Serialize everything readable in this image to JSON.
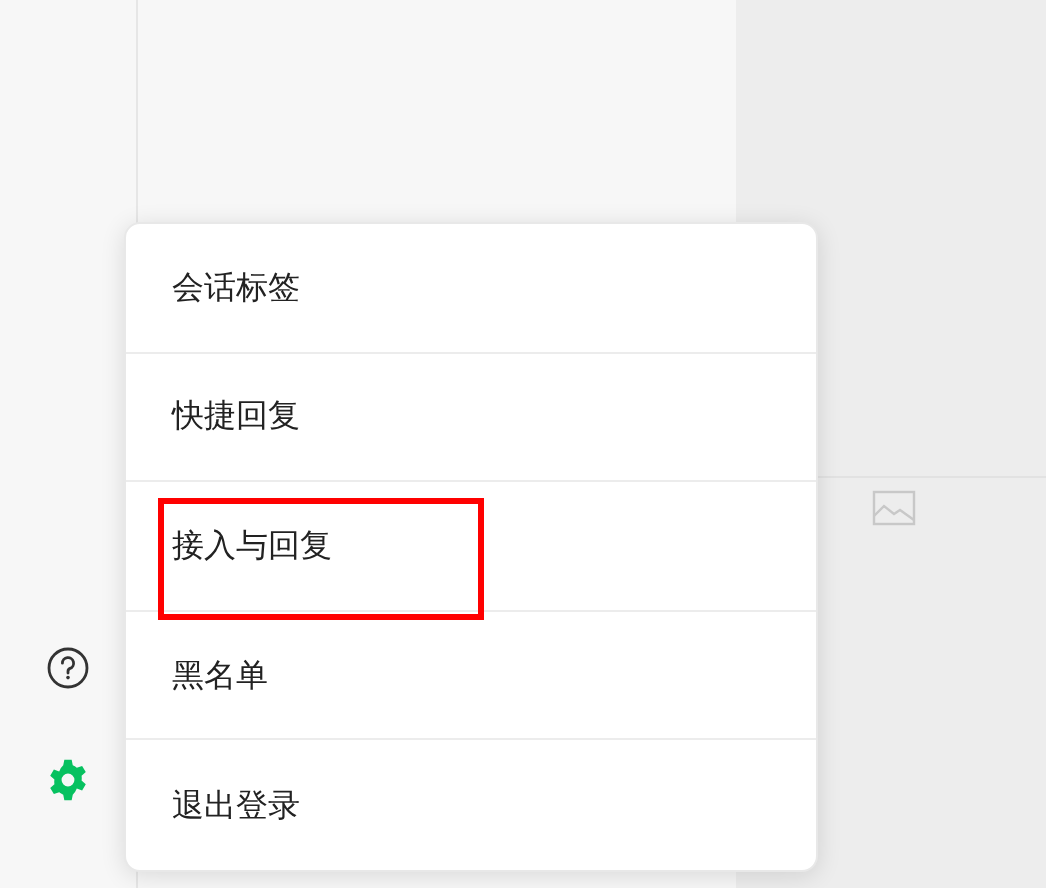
{
  "sidebar": {
    "icons": [
      {
        "kind": "help",
        "selected": false
      },
      {
        "kind": "settings",
        "selected": true
      }
    ]
  },
  "menu": {
    "items": [
      {
        "label": "会话标签",
        "highlighted": false
      },
      {
        "label": "快捷回复",
        "highlighted": false
      },
      {
        "label": "接入与回复",
        "highlighted": true
      },
      {
        "label": "黑名单",
        "highlighted": false
      },
      {
        "label": "退出登录",
        "highlighted": false
      }
    ]
  }
}
